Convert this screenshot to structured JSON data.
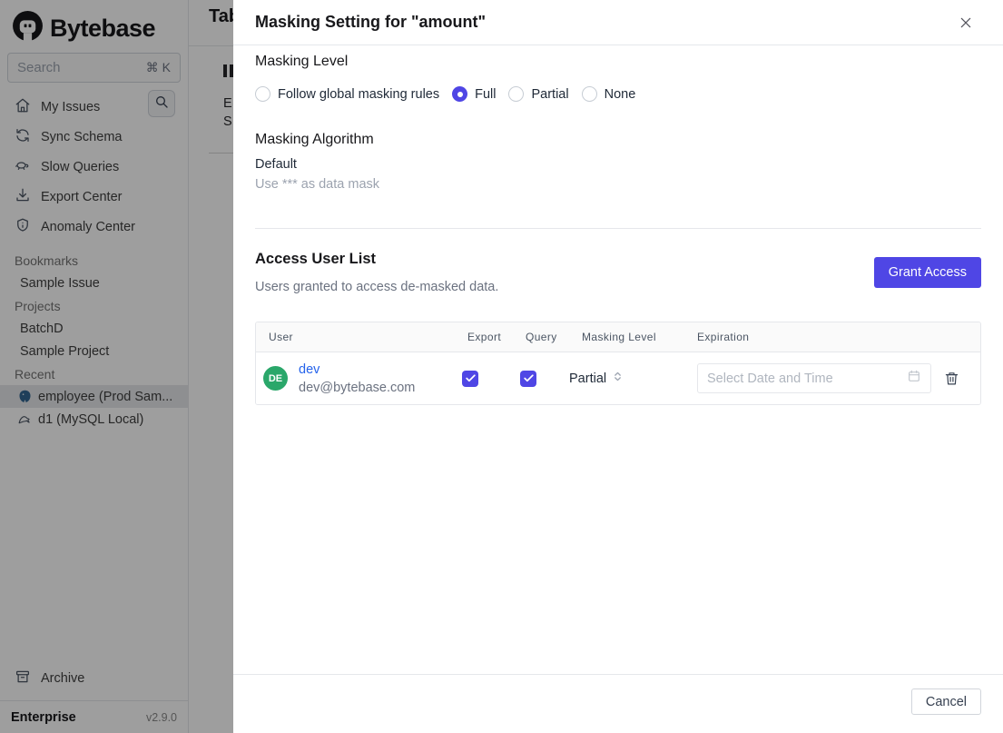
{
  "colors": {
    "accent": "#4f46e5",
    "link": "#2563eb",
    "avatar_green": "#2aa76a",
    "overlay": "rgba(0,0,0,0.38)"
  },
  "app": {
    "brand": "Bytebase",
    "sidebar": {
      "search_placeholder": "Search",
      "search_shortcut": "⌘ K",
      "nav": [
        {
          "label": "My Issues",
          "icon": "home-icon"
        },
        {
          "label": "Sync Schema",
          "icon": "sync-icon"
        },
        {
          "label": "Slow Queries",
          "icon": "turtle-icon"
        },
        {
          "label": "Export Center",
          "icon": "download-icon"
        },
        {
          "label": "Anomaly Center",
          "icon": "shield-icon"
        }
      ],
      "sections": [
        {
          "title": "Bookmarks",
          "items": [
            {
              "label": "Sample Issue"
            }
          ]
        },
        {
          "title": "Projects",
          "items": [
            {
              "label": "BatchD"
            },
            {
              "label": "Sample Project"
            }
          ]
        },
        {
          "title": "Recent",
          "items": [
            {
              "label": "employee (Prod Sam...",
              "icon": "postgres-icon",
              "selected": true
            },
            {
              "label": "d1 (MySQL Local)",
              "icon": "mysql-icon",
              "selected": false
            }
          ]
        }
      ],
      "archive_label": "Archive",
      "plan": "Enterprise",
      "version": "v2.9.0"
    },
    "page_behind": {
      "clipped_title": "Tab",
      "clipped_line1": "E",
      "clipped_line2": "S"
    }
  },
  "modal": {
    "title": "Masking Setting for \"amount\"",
    "masking_level": {
      "heading": "Masking Level",
      "options": [
        {
          "label": "Follow global masking rules",
          "selected": false
        },
        {
          "label": "Full",
          "selected": true
        },
        {
          "label": "Partial",
          "selected": false
        },
        {
          "label": "None",
          "selected": false
        }
      ]
    },
    "masking_algorithm": {
      "heading": "Masking Algorithm",
      "name": "Default",
      "description": "Use *** as data mask"
    },
    "access_user_list": {
      "heading": "Access User List",
      "subtitle": "Users granted to access de-masked data.",
      "grant_button": "Grant Access",
      "table": {
        "columns": [
          "User",
          "Export",
          "Query",
          "Masking Level",
          "Expiration"
        ],
        "rows": [
          {
            "avatar": "DE",
            "name": "dev",
            "email": "dev@bytebase.com",
            "export": true,
            "query": true,
            "masking_level": "Partial",
            "expiration_placeholder": "Select Date and Time"
          }
        ]
      }
    },
    "footer": {
      "cancel_label": "Cancel"
    }
  }
}
